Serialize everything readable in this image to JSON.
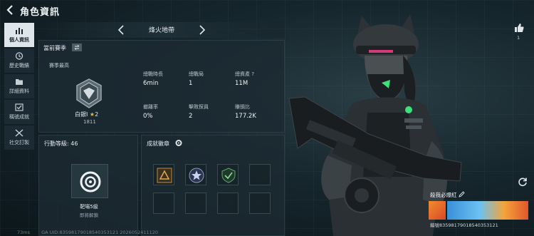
{
  "header": {
    "title": "角色資訊"
  },
  "sidebar": {
    "items": [
      {
        "label": "個人資訊",
        "active": true,
        "icon": "bar-chart-icon"
      },
      {
        "label": "歷史戰績",
        "active": false,
        "icon": "history-icon"
      },
      {
        "label": "詳細資料",
        "active": false,
        "icon": "folder-icon"
      },
      {
        "label": "稱號成就",
        "active": false,
        "icon": "shield-check-icon"
      },
      {
        "label": "社交訂製",
        "active": false,
        "icon": "tools-icon"
      }
    ]
  },
  "mode": {
    "title": "烽火地帶"
  },
  "season": {
    "heading": "當前賽季",
    "sub_heading": "賽季最高",
    "rank_name": "白銀I",
    "rank_stars": "2",
    "rank_score": "1811",
    "stats": [
      {
        "label": "總戰時長",
        "value": "6min"
      },
      {
        "label": "總戰局",
        "value": "1"
      },
      {
        "label": "總資產 ?",
        "value": "11M"
      },
      {
        "label": "撤離率",
        "value": "0%"
      },
      {
        "label": "擊敗探員",
        "value": "2"
      },
      {
        "label": "賺損比",
        "value": "177.2K"
      }
    ]
  },
  "level": {
    "heading": "行動等級: 46",
    "name": "靶場5級",
    "status": "即將解鎖"
  },
  "achievements": {
    "heading": "成就徽章"
  },
  "social": {
    "like_count": "1",
    "nickname": "殺我必爆紅",
    "uid": "編號83598179018540353121"
  },
  "footer": {
    "ping": "73ms",
    "build": "GA UID:83598179018540353121 2026052411120"
  },
  "colors": {
    "background": "#0f1c22",
    "panel": "#1c2a32",
    "accent_gold": "#e2b848",
    "active_tab": "#dfe6ea"
  }
}
